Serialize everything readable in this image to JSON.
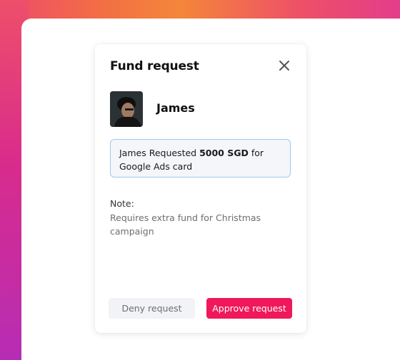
{
  "modal": {
    "title": "Fund request",
    "user": {
      "name": "James"
    },
    "request": {
      "prefix": "James Requested",
      "amount": "5000 SGD",
      "suffix": "for Google Ads card"
    },
    "note": {
      "label": "Note:",
      "text": "Requires extra fund for Christmas campaign"
    },
    "actions": {
      "deny_label": "Deny request",
      "approve_label": "Approve request"
    }
  },
  "icons": {
    "close": "close-icon"
  },
  "colors": {
    "accent": "#f0185a",
    "request_border": "#9fc9ea",
    "request_bg": "#f4f6fa",
    "deny_bg": "#f1f3f6"
  }
}
